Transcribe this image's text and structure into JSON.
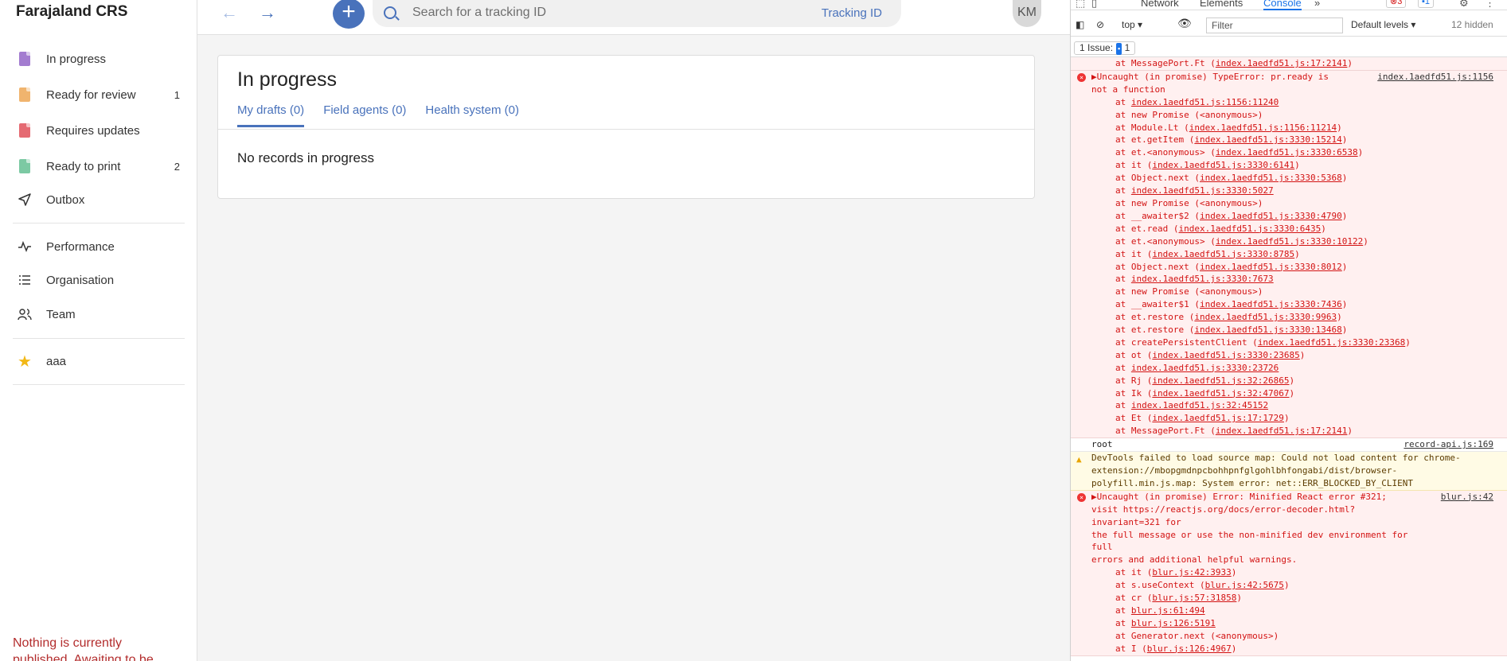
{
  "app": {
    "brand": "Farajaland CRS",
    "nav": [
      {
        "label": "In progress",
        "count": "",
        "color": "#a37cd0"
      },
      {
        "label": "Ready for review",
        "count": "1",
        "color": "#f0b46e"
      },
      {
        "label": "Requires updates",
        "count": "",
        "color": "#e56a72"
      },
      {
        "label": "Ready to print",
        "count": "2",
        "color": "#7cc9a3"
      },
      {
        "label": "Outbox",
        "count": ""
      }
    ],
    "nav2": [
      {
        "label": "Performance"
      },
      {
        "label": "Organisation"
      },
      {
        "label": "Team"
      }
    ],
    "favourite": {
      "label": "aaa"
    },
    "notice": "Nothing is currently published. Awaiting to be"
  },
  "topbar": {
    "back_icon": "←",
    "forward_icon": "→",
    "add_icon": "+",
    "search_placeholder": "Search for a tracking ID",
    "tracking_label": "Tracking ID",
    "avatar": "KM"
  },
  "main": {
    "title": "In progress",
    "tabs": [
      "My drafts (0)",
      "Field agents (0)",
      "Health system (0)"
    ],
    "empty": "No records in progress"
  },
  "devtools": {
    "tabs": [
      "Network",
      "Elements",
      "Console"
    ],
    "error_count": "3",
    "info_count": "1",
    "context": "top",
    "filter_placeholder": "Filter",
    "levels": "Default levels",
    "hidden": "12 hidden",
    "issues_label": "1 Issue:",
    "issues_count": "1",
    "messages": [
      {
        "type": "error-tail",
        "frames": [
          [
            "at MessagePort.Ft (",
            "index.1aedfd51.js:17:2141",
            ")"
          ]
        ]
      },
      {
        "type": "error",
        "text": "▶Uncaught (in promise) TypeError: pr.ready is\nnot a function",
        "src": "index.1aedfd51.js:1156",
        "frames": [
          [
            "at ",
            "index.1aedfd51.js:1156:11240",
            ""
          ],
          [
            "at new Promise (<anonymous>)",
            "",
            ""
          ],
          [
            "at Module.Lt (",
            "index.1aedfd51.js:1156:11214",
            ")"
          ],
          [
            "at et.getItem (",
            "index.1aedfd51.js:3330:15214",
            ")"
          ],
          [
            "at et.<anonymous> (",
            "index.1aedfd51.js:3330:6538",
            ")"
          ],
          [
            "at it (",
            "index.1aedfd51.js:3330:6141",
            ")"
          ],
          [
            "at Object.next (",
            "index.1aedfd51.js:3330:5368",
            ")"
          ],
          [
            "at ",
            "index.1aedfd51.js:3330:5027",
            ""
          ],
          [
            "at new Promise (<anonymous>)",
            "",
            ""
          ],
          [
            "at __awaiter$2 (",
            "index.1aedfd51.js:3330:4790",
            ")"
          ],
          [
            "at et.read (",
            "index.1aedfd51.js:3330:6435",
            ")"
          ],
          [
            "at et.<anonymous> (",
            "index.1aedfd51.js:3330:10122",
            ")"
          ],
          [
            "at it (",
            "index.1aedfd51.js:3330:8785",
            ")"
          ],
          [
            "at Object.next (",
            "index.1aedfd51.js:3330:8012",
            ")"
          ],
          [
            "at ",
            "index.1aedfd51.js:3330:7673",
            ""
          ],
          [
            "at new Promise (<anonymous>)",
            "",
            ""
          ],
          [
            "at __awaiter$1 (",
            "index.1aedfd51.js:3330:7436",
            ")"
          ],
          [
            "at et.restore (",
            "index.1aedfd51.js:3330:9963",
            ")"
          ],
          [
            "at et.restore (",
            "index.1aedfd51.js:3330:13468",
            ")"
          ],
          [
            "at createPersistentClient (",
            "index.1aedfd51.js:3330:23368",
            ")"
          ],
          [
            "at ot (",
            "index.1aedfd51.js:3330:23685",
            ")"
          ],
          [
            "at ",
            "index.1aedfd51.js:3330:23726",
            ""
          ],
          [
            "at Rj (",
            "index.1aedfd51.js:32:26865",
            ")"
          ],
          [
            "at Ik (",
            "index.1aedfd51.js:32:47067",
            ")"
          ],
          [
            "at ",
            "index.1aedfd51.js:32:45152",
            ""
          ],
          [
            "at Et (",
            "index.1aedfd51.js:17:1729",
            ")"
          ],
          [
            "at MessagePort.Ft (",
            "index.1aedfd51.js:17:2141",
            ")"
          ]
        ]
      },
      {
        "type": "log",
        "text": "root",
        "src": "record-api.js:169"
      },
      {
        "type": "warn",
        "text": "DevTools failed to load source map: Could not load content for chrome-extension://mbopgmdnpcbohhpnfglgohlbhfongabi/dist/browser-polyfill.min.js.map: System error: net::ERR_BLOCKED_BY_CLIENT"
      },
      {
        "type": "error",
        "text": "▶Uncaught (in promise) Error: Minified React error #321;\nvisit https://reactjs.org/docs/error-decoder.html?invariant=321 for\nthe full message or use the non-minified dev environment for full\nerrors and additional helpful warnings.",
        "src": "blur.js:42",
        "frames": [
          [
            "at it (",
            "blur.js:42:3933",
            ")"
          ],
          [
            "at s.useContext (",
            "blur.js:42:5675",
            ")"
          ],
          [
            "at cr (",
            "blur.js:57:31858",
            ")"
          ],
          [
            "at ",
            "blur.js:61:494",
            ""
          ],
          [
            "at ",
            "blur.js:126:5191",
            ""
          ],
          [
            "at Generator.next (<anonymous>)",
            "",
            ""
          ],
          [
            "at I (",
            "blur.js:126:4967",
            ")"
          ]
        ]
      }
    ]
  }
}
